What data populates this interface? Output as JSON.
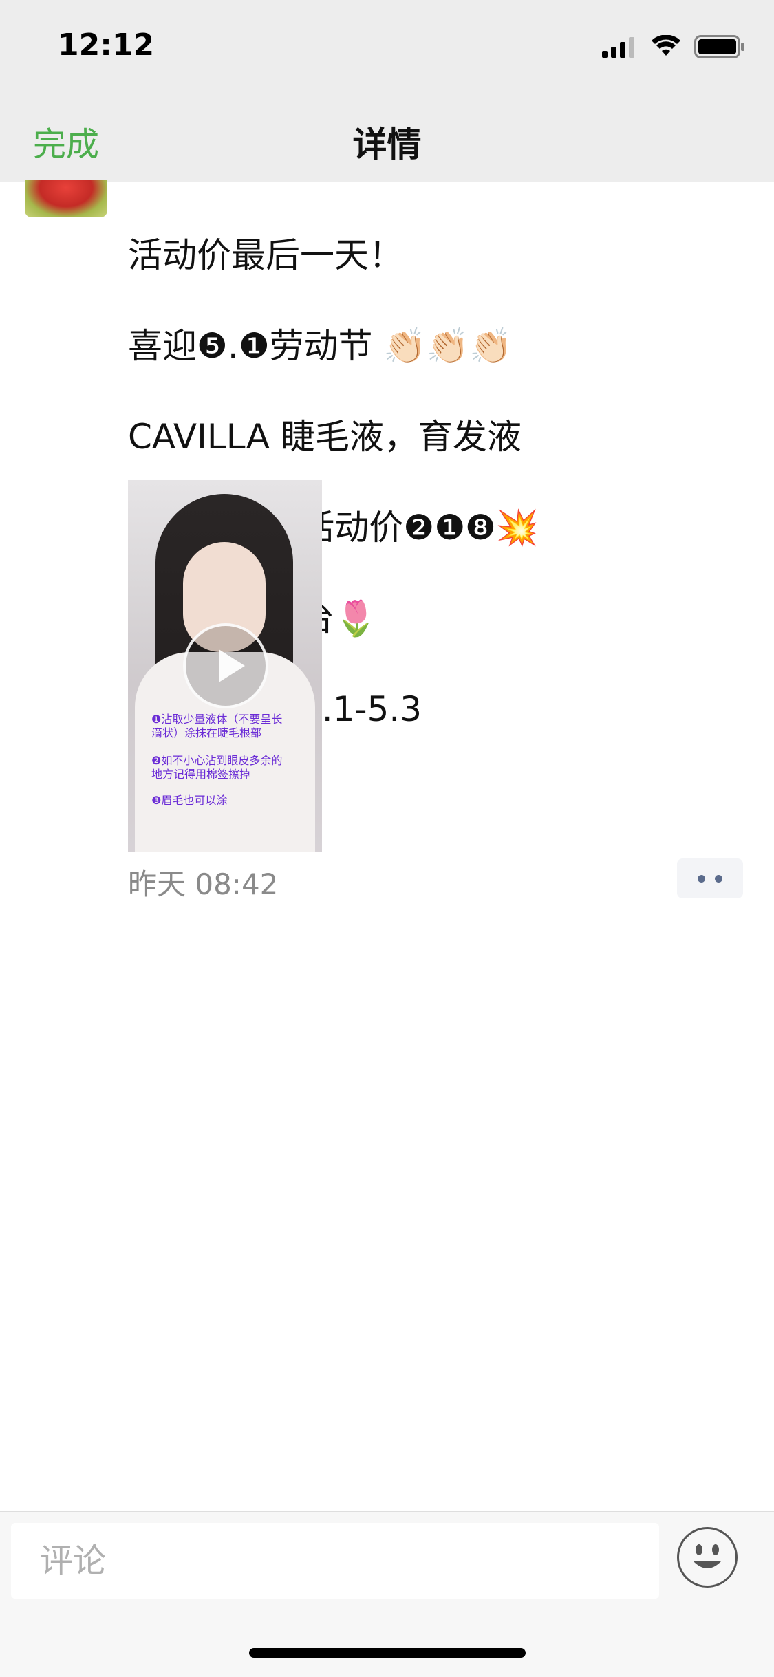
{
  "status": {
    "time": "12:12"
  },
  "nav": {
    "done_label": "完成",
    "title": "详情"
  },
  "post": {
    "lines": [
      "活动价最后一天！",
      "喜迎❺.❶劳动节 👏🏻👏🏻👏🏻",
      "CAVILLA 睫毛液，育发液",
      "原价❷❸❽ 活动价❷❶❽💥",
      "只限微信平台🌷",
      "活动时间：5.1-5.3"
    ],
    "video_overlay": [
      "❶沾取少量液体（不要呈长\n滴状）涂抹在睫毛根部",
      "❷如不小心沾到眼皮多余的\n地方记得用棉签擦掉",
      "❸眉毛也可以涂"
    ],
    "timestamp": "昨天 08:42"
  },
  "comment": {
    "placeholder": "评论"
  },
  "colors": {
    "accent_green": "#4cae4c",
    "link_blue": "#5b6b8c",
    "overlay_purple": "#6a2bd6"
  },
  "icons": {
    "signal": "cellular-signal-icon",
    "wifi": "wifi-icon",
    "battery": "battery-icon",
    "play": "play-icon",
    "more": "more-dots-icon",
    "emoji": "emoji-face-icon"
  }
}
